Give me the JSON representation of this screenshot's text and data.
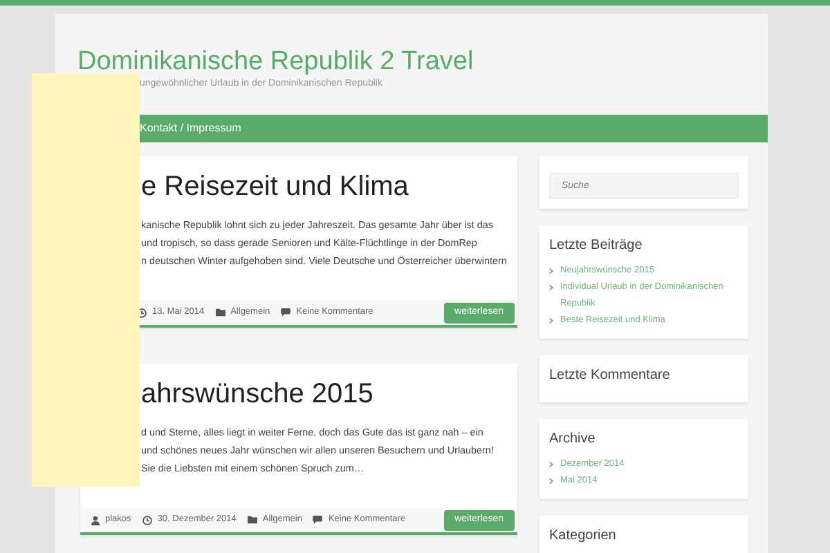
{
  "site": {
    "title": "Dominikanische Republik 2 Travel",
    "tagline": "ungewöhnlicher Urlaub in der Dominikanischen Republik"
  },
  "nav": {
    "items": [
      "Kontakt / Impressum"
    ]
  },
  "posts": [
    {
      "title": "e Reisezeit und Klima",
      "excerpt": [
        "kanische Republik lohnt sich zu jeder Jahreszeit. Das gesamte Jahr über ist das",
        "und tropisch, so dass gerade Senioren und Kälte-Flüchtlinge in der DomRep",
        "n deutschen Winter aufgehoben sind. Viele Deutsche und Österreicher überwintern"
      ],
      "date": "13. Mai 2014",
      "category": "Allgemein",
      "comments": "Keine Kommentare",
      "button": "weiterlesen"
    },
    {
      "title": "ahrswünsche 2015",
      "excerpt": [
        "d und Sterne, alles liegt in weiter Ferne, doch das Gute das ist ganz nah – ein",
        "und schönes neues Jahr wünschen wir allen unseren Besuchern und Urlaubern!",
        "Sie die Liebsten mit einem schönen Spruch zum…"
      ],
      "author": "plakos",
      "date": "30. Dezember 2014",
      "category": "Allgemein",
      "comments": "Keine Kommentare",
      "button": "weiterlesen"
    }
  ],
  "sidebar": {
    "search": {
      "placeholder": "Suche"
    },
    "widgets": [
      {
        "title": "Letzte Beiträge",
        "items": [
          "Neujahrswünsche 2015",
          "Individual Urlaub in der Dominikanischen Republik",
          "Beste Reisezeit und Klima"
        ]
      },
      {
        "title": "Letzte Kommentare"
      },
      {
        "title": "Archive",
        "items": [
          "Dezember 2014",
          "Mai 2014"
        ]
      },
      {
        "title": "Kategorien"
      }
    ]
  }
}
